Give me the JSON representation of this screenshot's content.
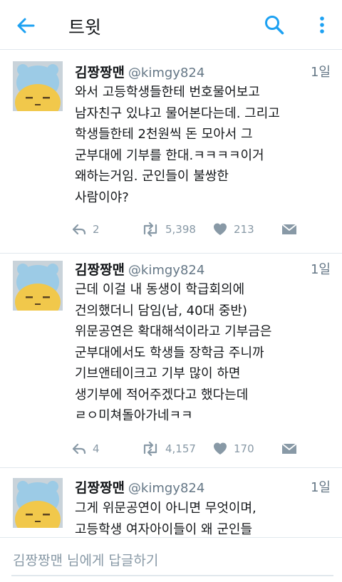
{
  "header": {
    "title": "트윗",
    "back_icon": "arrow-left-icon",
    "search_icon": "search-icon",
    "more_icon": "more-vertical-icon",
    "accent_color": "#1da1f2"
  },
  "tweets": [
    {
      "name": "김짱짱맨",
      "handle": "@kimgy824",
      "time": "1일",
      "lines": [
        "와서 고등학생들한테 번호물어보고",
        "남자친구 있냐고 물어본다는데. 그리고",
        "학생들한테 2천원씩 돈 모아서 그",
        "군부대에 기부를 한대.ㅋㅋㅋㅋ이거",
        "왜하는거임. 군인들이 불쌍한",
        "사람이야?"
      ],
      "replies": "2",
      "retweets": "5,398",
      "likes": "213"
    },
    {
      "name": "김짱짱맨",
      "handle": "@kimgy824",
      "time": "1일",
      "lines": [
        "근데 이걸 내 동생이 학급회의에",
        "건의했더니 담임(남, 40대 중반)",
        "위문공연은 확대해석이라고 기부금은",
        "군부대에서도 학생들 장학금 주니까",
        "기브앤테이크고 기부 많이 하면",
        "생기부에 적어주겠다고 했다는데",
        "ㄹㅇ미쳐돌아가네ㅋㅋ"
      ],
      "replies": "4",
      "retweets": "4,157",
      "likes": "170"
    },
    {
      "name": "김짱짱맨",
      "handle": "@kimgy824",
      "time": "1일",
      "lines": [
        "그게 위문공연이 아니면 무엇이며,",
        "고등학생 여자아이들이 왜 군인들"
      ]
    }
  ],
  "reply": {
    "placeholder": "김짱짱맨 님에게 답글하기"
  }
}
